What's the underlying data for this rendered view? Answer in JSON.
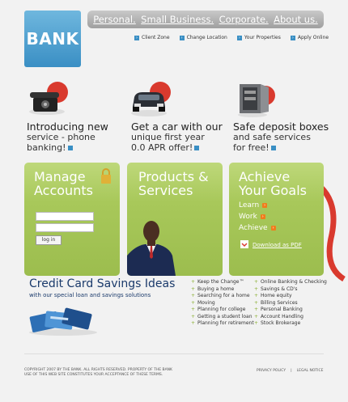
{
  "logo": "BANK",
  "nav": {
    "top": [
      "Personal.",
      "Small Business.",
      "Corporate.",
      "About us."
    ],
    "sub": [
      "Client Zone",
      "Change Location",
      "Your Properties",
      "Apply Online"
    ]
  },
  "features": [
    {
      "line1": "Introducing new",
      "line2": "service - phone",
      "line3": "banking!"
    },
    {
      "line1": "Get a car with our",
      "line2": "unique first year",
      "line3": "0.0 APR offer!"
    },
    {
      "line1": "Safe deposit boxes",
      "line2": "and safe services",
      "line3": "for free!"
    }
  ],
  "panels": {
    "manage": {
      "line1": "Manage",
      "line2": "Accounts",
      "login_label": "log in"
    },
    "products": {
      "line1": "Products &",
      "line2": "Services"
    },
    "goals": {
      "line1": "Achieve",
      "line2": "Your Goals",
      "links": [
        "Learn",
        "Work",
        "Achieve"
      ],
      "pdf": "Download as PDF"
    }
  },
  "credit": {
    "title": "Credit Card Savings Ideas",
    "subtitle": "with our special loan and savings solutions"
  },
  "list_left": [
    "Keep the Change™",
    "Buying a home",
    "Searching for a home",
    "Moving",
    "Planning for college",
    "Getting a student loan",
    "Planning for retirement"
  ],
  "list_right": [
    "Online Banking & Checking",
    "Savings & CD's",
    "Home equity",
    "Billing Services",
    "Personal Banking",
    "Account Handling",
    "Stock Brokerage"
  ],
  "footer": {
    "copyright1": "COPYRIGHT 2007 BY THE BANK. ALL RIGHTS RESERVED. PROPERTY OF THE BANK",
    "copyright2": "USE OF THIS WEB SITE CONSTITUTES YOUR ACCEPTANCE OF THESE TERMS.",
    "privacy": "PRIVACY POLICY",
    "separator": "|",
    "legal": "LEGAL NOTICE"
  },
  "colors": {
    "green": "#a8c85a",
    "blue": "#3a8fc4",
    "red": "#d93a2e",
    "navy": "#1a3a6b"
  }
}
